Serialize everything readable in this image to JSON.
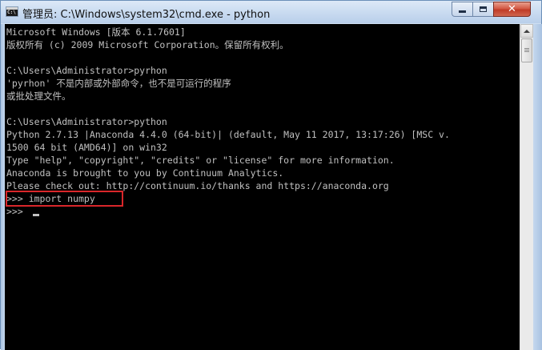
{
  "window": {
    "title": "管理员: C:\\Windows\\system32\\cmd.exe - python",
    "icon": "cmd-icon",
    "icon_text": "C:\\"
  },
  "controls": {
    "minimize_icon": "minimize-icon",
    "maximize_icon": "maximize-icon",
    "close_glyph": "✕"
  },
  "console": {
    "lines": [
      "Microsoft Windows [版本 6.1.7601]",
      "版权所有 (c) 2009 Microsoft Corporation。保留所有权利。",
      "",
      "C:\\Users\\Administrator>pyrhon",
      "'pyrhon' 不是内部或外部命令，也不是可运行的程序",
      "或批处理文件。",
      "",
      "C:\\Users\\Administrator>python",
      "Python 2.7.13 |Anaconda 4.4.0 (64-bit)| (default, May 11 2017, 13:17:26) [MSC v.",
      "1500 64 bit (AMD64)] on win32",
      "Type \"help\", \"copyright\", \"credits\" or \"license\" for more information.",
      "Anaconda is brought to you by Continuum Analytics.",
      "Please check out: http://continuum.io/thanks and https://anaconda.org",
      ">>> import numpy",
      ">>> "
    ],
    "highlight_color": "#d9262a",
    "text_color": "#c0c0c0",
    "background": "#000000"
  }
}
